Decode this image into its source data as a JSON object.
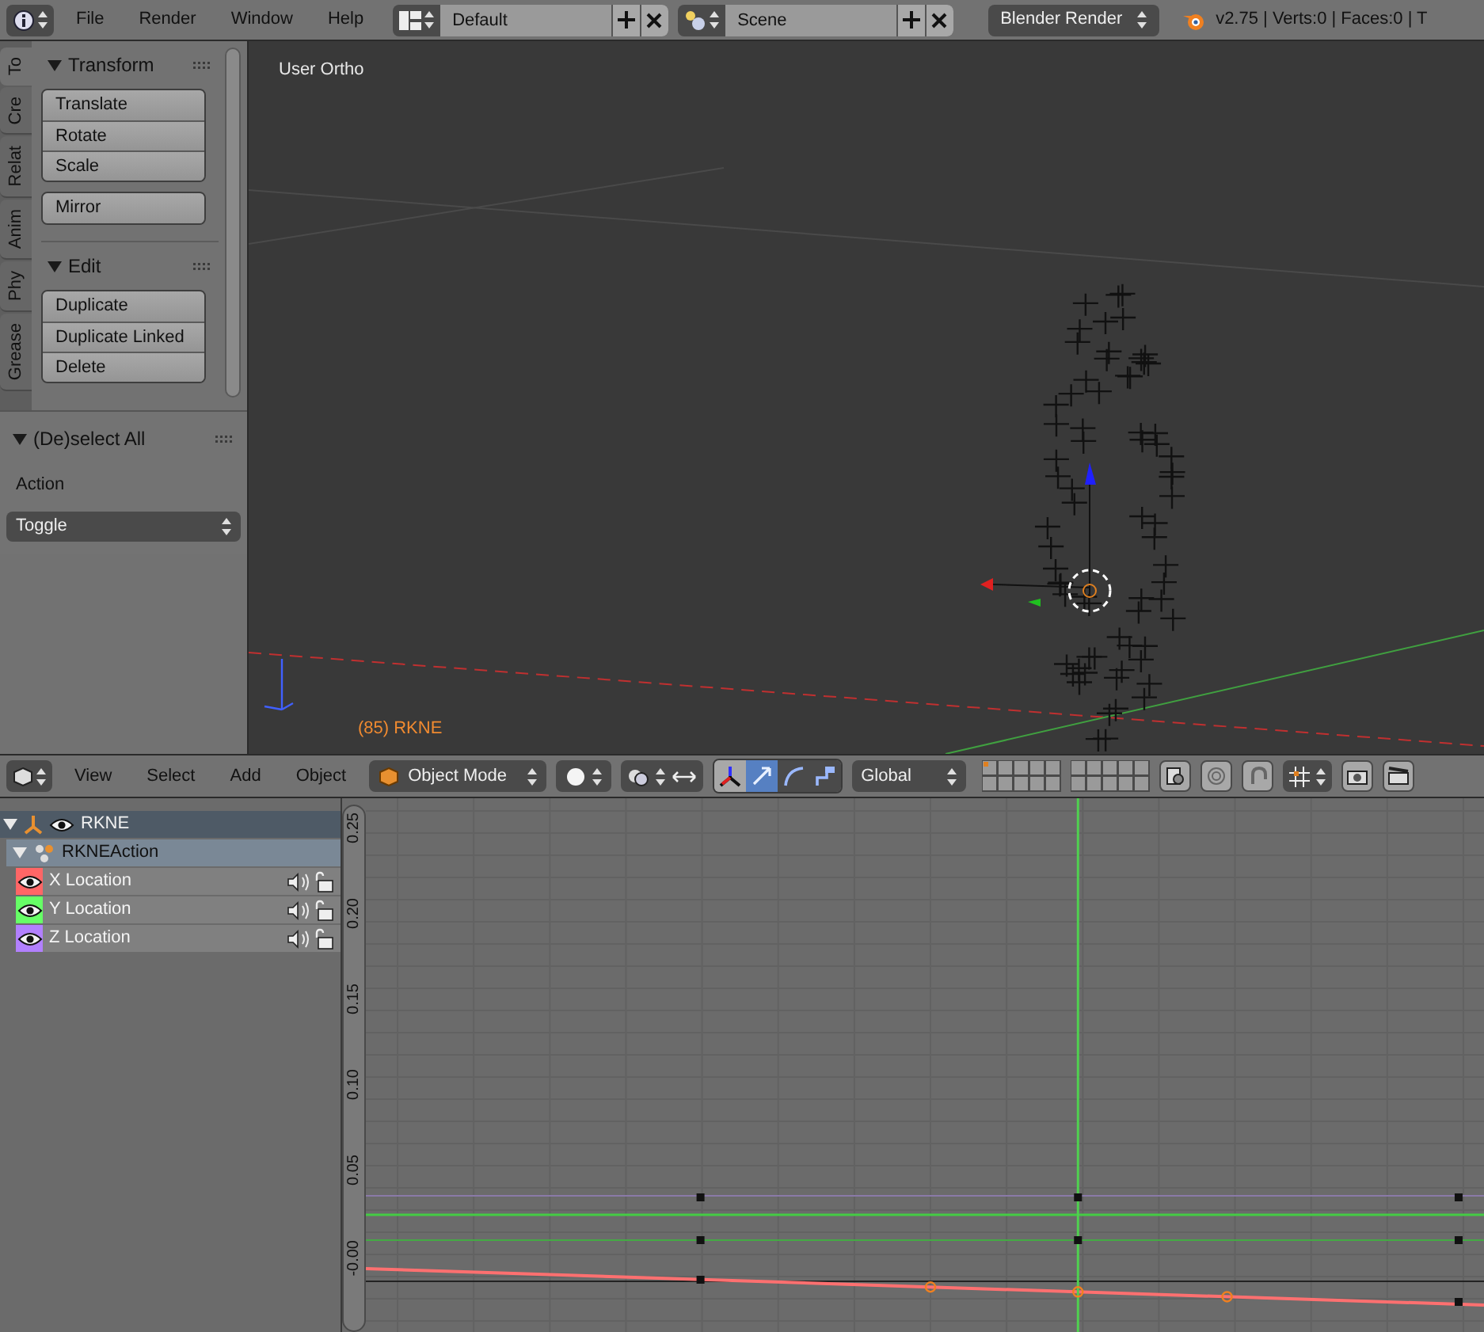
{
  "top_bar": {
    "menus": [
      "File",
      "Render",
      "Window",
      "Help"
    ],
    "layout": "Default",
    "scene": "Scene",
    "engine": "Blender Render",
    "stats": "v2.75 | Verts:0 | Faces:0 | T"
  },
  "tool_tabs": [
    {
      "label": "To",
      "selected": true
    },
    {
      "label": "Cre",
      "selected": false
    },
    {
      "label": "Relat",
      "selected": false
    },
    {
      "label": "Anim",
      "selected": false
    },
    {
      "label": "Phy",
      "selected": false
    },
    {
      "label": "Grease",
      "selected": false
    }
  ],
  "panels": [
    {
      "title": "Transform",
      "expanded": true,
      "groups": [
        [
          "Translate",
          "Rotate",
          "Scale"
        ],
        [
          "Mirror"
        ]
      ]
    },
    {
      "title": "Edit",
      "expanded": true,
      "groups": [
        [
          "Duplicate",
          "Duplicate Linked",
          "Delete"
        ]
      ]
    }
  ],
  "operator": {
    "title": "(De)select All",
    "expanded": true,
    "label": "Action",
    "value": "Toggle"
  },
  "viewport": {
    "view_name": "User Ortho",
    "object_label": "(85) RKNE"
  },
  "header": {
    "menus": [
      "View",
      "Select",
      "Add",
      "Object"
    ],
    "mode": "Object Mode",
    "orientation": "Global"
  },
  "channels": {
    "object": {
      "name": "RKNE",
      "expanded": true
    },
    "action": {
      "name": "RKNEAction",
      "expanded": true
    },
    "curves": [
      {
        "name": "X Location",
        "color": "#ff6666"
      },
      {
        "name": "Y Location",
        "color": "#66ff66"
      },
      {
        "name": "Z Location",
        "color": "#b280ff"
      }
    ]
  },
  "graph": {
    "y_ticks": [
      "0.25",
      "0.20",
      "0.15",
      "0.10",
      "0.05",
      "-0.00"
    ]
  }
}
